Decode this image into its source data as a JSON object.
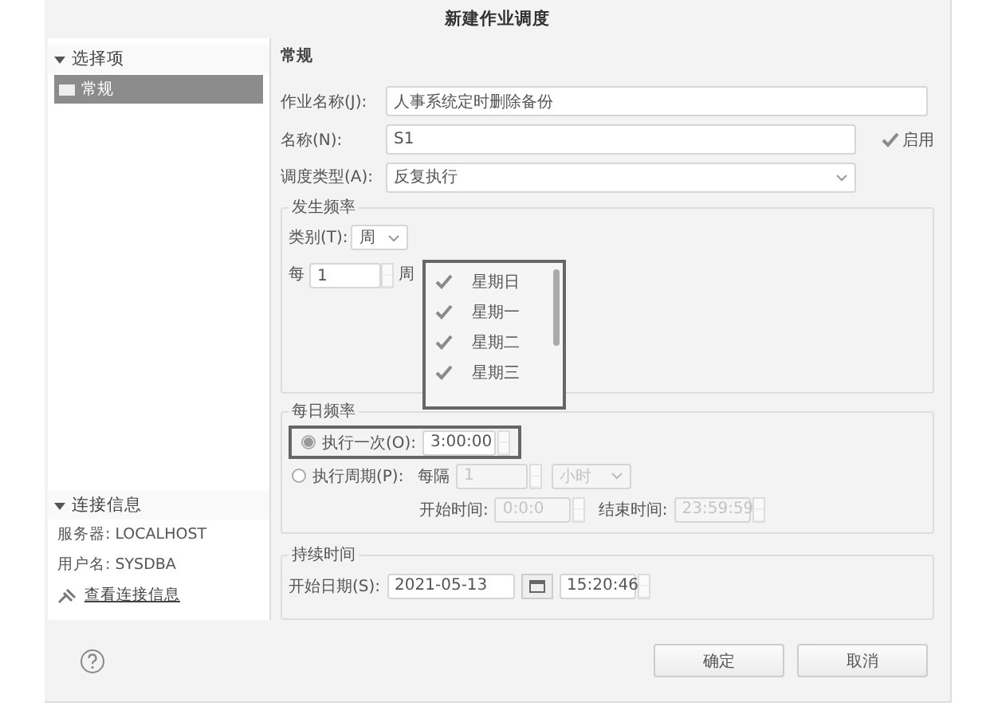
{
  "window": {
    "title": "新建作业调度"
  },
  "sidebar": {
    "sections": [
      {
        "label": "选择项",
        "expanded": true,
        "items": [
          {
            "label": "常规",
            "selected": true
          }
        ]
      }
    ],
    "connection": {
      "label": "连接信息",
      "expanded": true,
      "server": "服务器: LOCALHOST",
      "user": "用户名: SYSDBA",
      "link": "查看连接信息"
    }
  },
  "page_title": "常规",
  "job_name": {
    "label": "作业名称(J):",
    "value": "人事系统定时删除备份"
  },
  "name": {
    "label": "名称(N):",
    "value": "S1"
  },
  "enabled": {
    "label": "启用",
    "checked": true
  },
  "schedule_type": {
    "label": "调度类型(A):",
    "value": "反复执行"
  },
  "frequency": {
    "legend": "发生频率",
    "category_label": "类别(T):",
    "category": "周",
    "every_label": "每",
    "every_value": "1",
    "unit": "周",
    "days": [
      {
        "label": "星期日",
        "checked": true
      },
      {
        "label": "星期一",
        "checked": true
      },
      {
        "label": "星期二",
        "checked": true
      },
      {
        "label": "星期三",
        "checked": true
      }
    ]
  },
  "daily": {
    "legend": "每日频率",
    "options": [
      {
        "label": "执行一次(O):",
        "selected": true
      },
      {
        "label": "执行周期(P):",
        "selected": false
      }
    ],
    "once_time": "3:00:00",
    "interval_label": "每隔",
    "interval_value": "1",
    "interval_unit": "小时",
    "start_label": "开始时间:",
    "start_time": "0:0:0",
    "end_label": "结束时间:",
    "end_time": "23:59:59"
  },
  "duration": {
    "legend": "持续时间",
    "start_label": "开始日期(S):",
    "start_date": "2021-05-13",
    "start_time": "15:20:46"
  },
  "buttons": [
    {
      "label": "确定"
    },
    {
      "label": "取消"
    }
  ]
}
